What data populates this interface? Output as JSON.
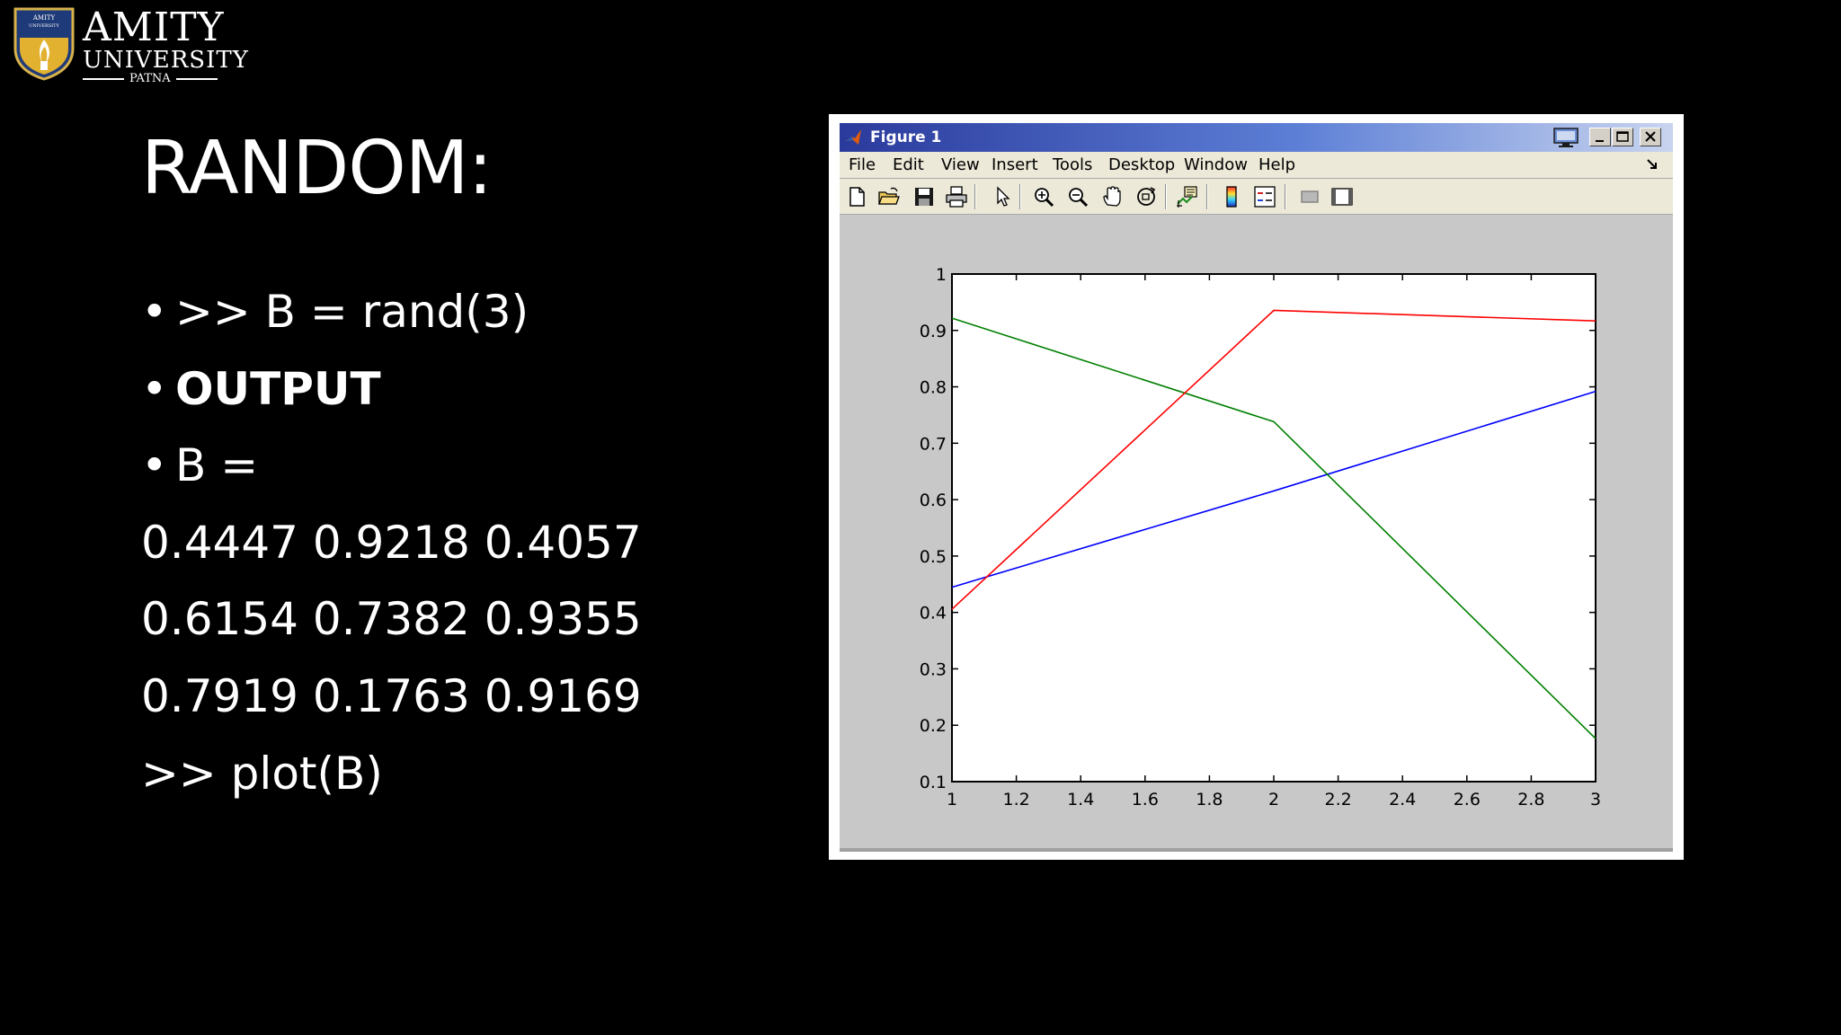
{
  "logo": {
    "line1": "AMITY",
    "line2": "UNIVERSITY",
    "line3": "PATNA",
    "shield_text": "AMITY UNIVERSITY"
  },
  "slide": {
    "title": "RANDOM:",
    "bullets": [
      ">> B = rand(3)",
      "OUTPUT",
      "B ="
    ],
    "rows": [
      "0.4447 0.9218 0.4057",
      "0.6154 0.7382 0.9355",
      "0.7919 0.1763 0.9169"
    ],
    "command": ">> plot(B)"
  },
  "window": {
    "title": "Figure 1",
    "menus": [
      "File",
      "Edit",
      "View",
      "Insert",
      "Tools",
      "Desktop",
      "Window",
      "Help"
    ],
    "toolbar_icons": [
      "new-file-icon",
      "open-folder-icon",
      "save-icon",
      "print-icon",
      "arrow-cursor-icon",
      "zoom-in-icon",
      "zoom-out-icon",
      "pan-hand-icon",
      "rotate-3d-icon",
      "data-cursor-icon",
      "colorbar-icon",
      "legend-icon",
      "hide-plot-tools-icon",
      "show-plot-tools-icon"
    ]
  },
  "colors": {
    "background": "#000000",
    "text": "#ffffff",
    "series1": "#0000ff",
    "series2": "#008000",
    "series3": "#ff0000"
  },
  "chart_data": {
    "type": "line",
    "x": [
      1,
      2,
      3
    ],
    "xlim": [
      1,
      3
    ],
    "ylim": [
      0.1,
      1
    ],
    "xticks": [
      "1",
      "1.2",
      "1.4",
      "1.6",
      "1.8",
      "2",
      "2.2",
      "2.4",
      "2.6",
      "2.8",
      "3"
    ],
    "yticks": [
      "0.1",
      "0.2",
      "0.3",
      "0.4",
      "0.5",
      "0.6",
      "0.7",
      "0.8",
      "0.9",
      "1"
    ],
    "grid": false,
    "series": [
      {
        "values": [
          0.4447,
          0.6154,
          0.7919
        ],
        "color": "#0000ff"
      },
      {
        "values": [
          0.9218,
          0.7382,
          0.1763
        ],
        "color": "#008000"
      },
      {
        "values": [
          0.4057,
          0.9355,
          0.9169
        ],
        "color": "#ff0000"
      }
    ]
  }
}
